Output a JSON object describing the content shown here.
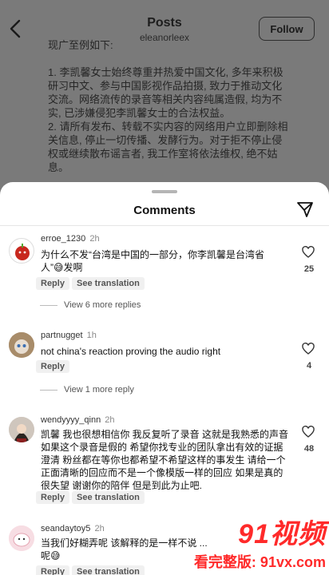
{
  "header": {
    "title": "Posts",
    "username": "eleanorleex",
    "follow_label": "Follow"
  },
  "post_text": "现广至例如下:\n\n1. 李凯馨女士始终尊重并热爱中国文化, 多年来积极研习中文、参与中国影视作品拍摄, 致力于推动文化交流。网络流传的录音等相关内容纯属造假, 均为不实, 已涉嫌侵犯李凯馨女士的合法权益。\n2. 请所有发布、转载不实内容的网络用户立即删除相关信息, 停止一切传播、发酵行为。对于拒不停止侵权或继续散布谣言者, 我工作室将依法维权, 绝不姑息。\n\n我们呼吁广大网友理性甄别网络信息, 切勿传播不实信息, 共同维护清朗的网络环境。",
  "sheet": {
    "title": "Comments"
  },
  "comments": [
    {
      "user": "erroe_1230",
      "time": "2h",
      "text": "为什么不发“台湾是中国的一部分，你李凯馨是台湾省人”😅发啊",
      "reply_label": "Reply",
      "translate_label": "See translation",
      "likes": "25",
      "view_replies": "View 6 more replies"
    },
    {
      "user": "partnugget",
      "time": "1h",
      "text": "not china's reaction proving the audio right",
      "reply_label": "Reply",
      "likes": "4",
      "view_replies": "View 1 more reply"
    },
    {
      "user": "wendyyyy_qinn",
      "time": "2h",
      "text": "凯馨 我也很想相信你 我反复听了录音 这就是我熟悉的声音 如果这个录音是假的 希望你找专业的团队拿出有效的证据澄清 粉丝都在等你也都希望不希望这样的事发生 请给一个正面清晰的回应而不是一个像模版一样的回应 如果是真的 很失望 谢谢你的陪伴 但是到此为止吧.",
      "reply_label": "Reply",
      "translate_label": "See translation",
      "likes": "48"
    },
    {
      "user": "seandaytoy5",
      "time": "2h",
      "text": "当我们好糊弄呢 该解释的是一样不说 ...\n呢😅",
      "reply_label": "Reply",
      "translate_label": "See translation"
    }
  ],
  "watermark": {
    "line1": "91视频",
    "line2": "看完整版: 91vx.com"
  },
  "colors": {
    "accent_watermark": "#ff2a2a",
    "sheet_bg": "#ffffff",
    "overlay_bg": "#7a7a7a"
  }
}
